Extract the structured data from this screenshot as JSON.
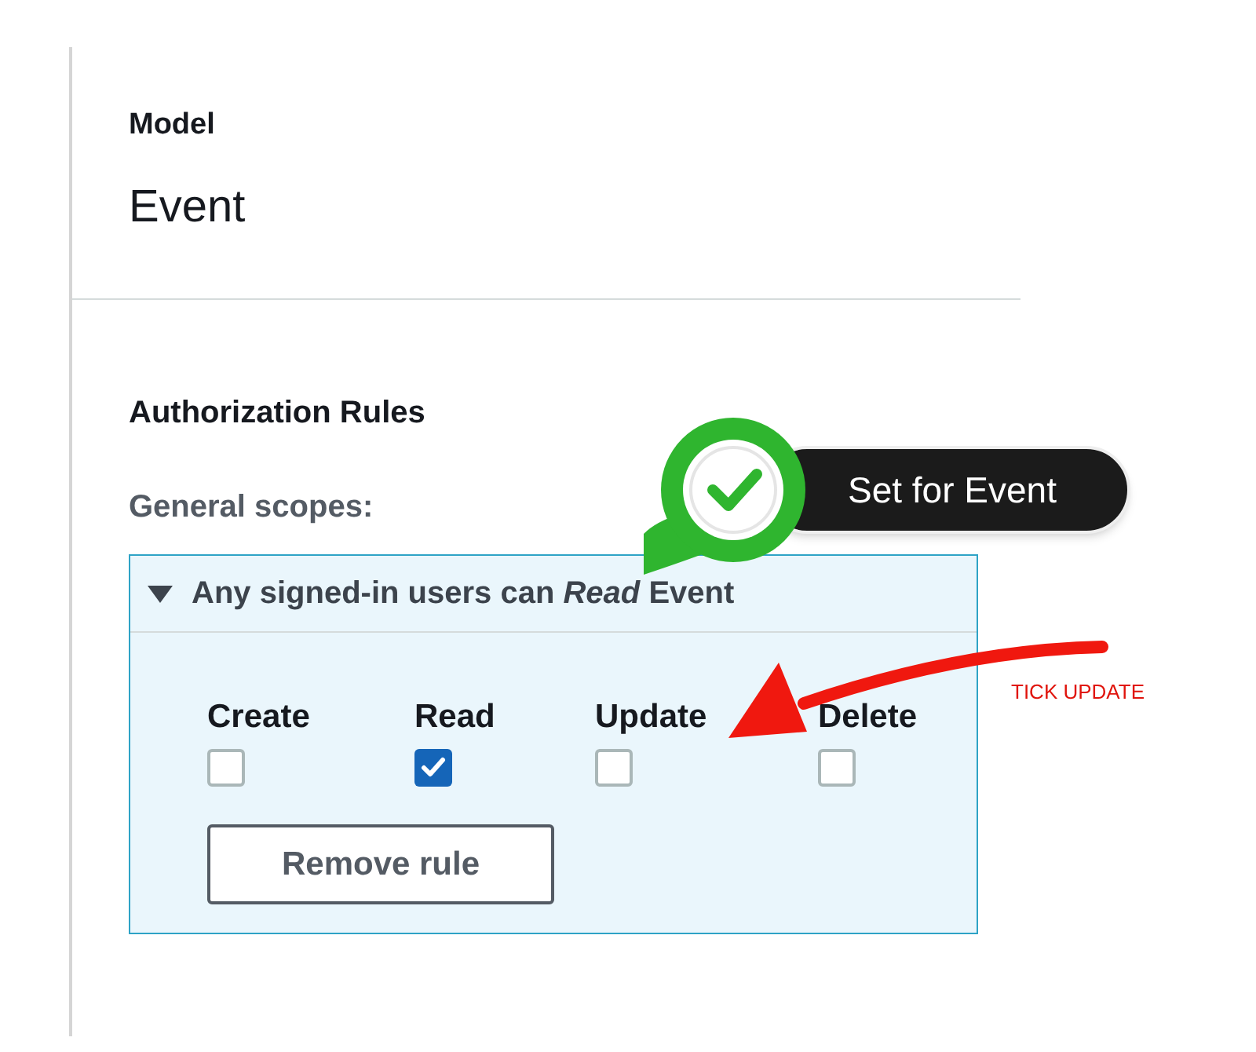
{
  "model": {
    "label": "Model",
    "value": "Event"
  },
  "authorization": {
    "heading": "Authorization Rules",
    "scopes_label": "General scopes:",
    "rule": {
      "expanded": true,
      "title": "Any signed-in users can *Read* Event",
      "permissions": [
        {
          "label": "Create",
          "checked": false
        },
        {
          "label": "Read",
          "checked": true
        },
        {
          "label": "Update",
          "checked": false
        },
        {
          "label": "Delete",
          "checked": false
        }
      ],
      "remove_button": "Remove rule"
    }
  },
  "annotations": {
    "badge": "Set for Event",
    "note": "TICK UPDATE"
  }
}
